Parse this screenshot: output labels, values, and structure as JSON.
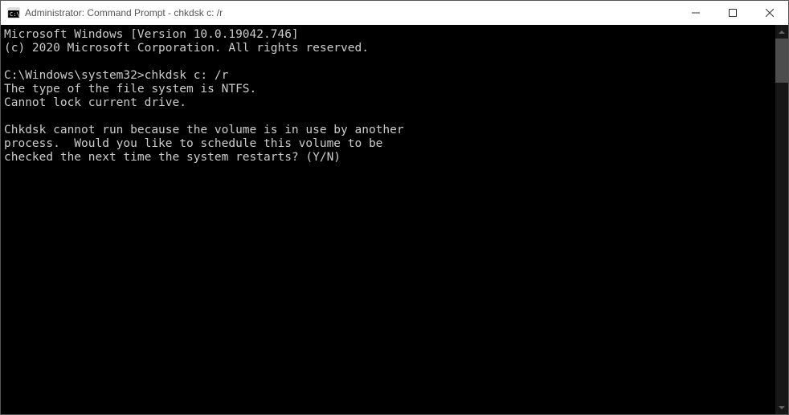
{
  "window": {
    "title": "Administrator: Command Prompt - chkdsk  c: /r"
  },
  "console": {
    "lines": [
      "Microsoft Windows [Version 10.0.19042.746]",
      "(c) 2020 Microsoft Corporation. All rights reserved.",
      "",
      "C:\\Windows\\system32>chkdsk c: /r",
      "The type of the file system is NTFS.",
      "Cannot lock current drive.",
      "",
      "Chkdsk cannot run because the volume is in use by another",
      "process.  Would you like to schedule this volume to be",
      "checked the next time the system restarts? (Y/N)"
    ]
  }
}
